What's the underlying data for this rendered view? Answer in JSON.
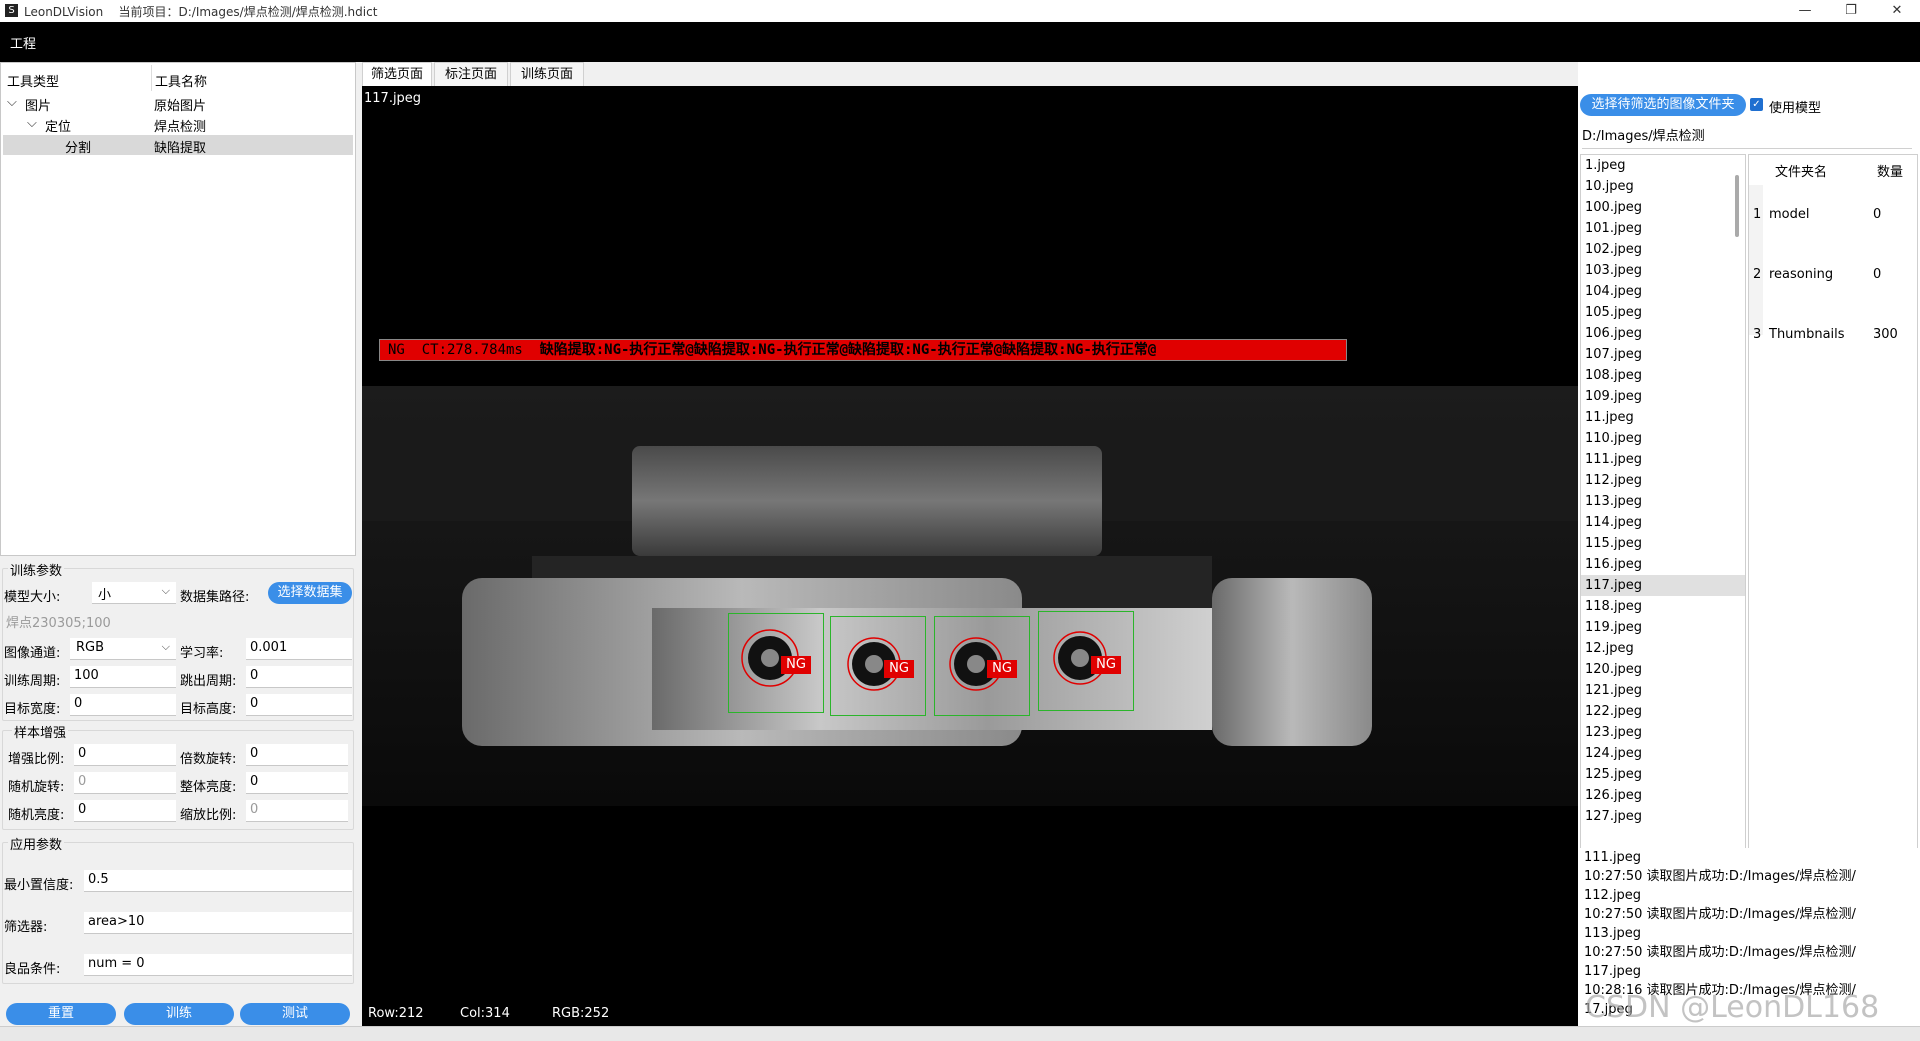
{
  "titlebar": {
    "app_name": "LeonDLVision",
    "project_label": "当前项目：D:/Images/焊点检测/焊点检测.hdict",
    "minimize_glyph": "—",
    "maximize_glyph": "❐",
    "close_glyph": "✕"
  },
  "menu": {
    "project": "工程"
  },
  "tree": {
    "col_type": "工具类型",
    "col_name": "工具名称",
    "rows": [
      {
        "type": "图片",
        "name": "原始图片"
      },
      {
        "type": "定位",
        "name": "焊点检测"
      },
      {
        "type": "分割",
        "name": "缺陷提取"
      }
    ]
  },
  "train": {
    "group_title": "训练参数",
    "model_size_label": "模型大小:",
    "model_size_value": "小",
    "dataset_path_label": "数据集路径:",
    "select_dataset_button": "选择数据集",
    "dataset_value": "焊点230305;100",
    "channel_label": "图像通道:",
    "channel_value": "RGB",
    "lr_label": "学习率:",
    "lr_value": "0.001",
    "epochs_label": "训练周期:",
    "epochs_value": "100",
    "skip_label": "跳出周期:",
    "skip_value": "0",
    "target_width_label": "目标宽度:",
    "target_width_value": "0",
    "target_height_label": "目标高度:",
    "target_height_value": "0"
  },
  "augment": {
    "group_title": "样本增强",
    "ratio_label": "增强比例:",
    "ratio_value": "0",
    "multi_rot_label": "倍数旋转:",
    "multi_rot_value": "0",
    "rand_rot_label": "随机旋转:",
    "rand_rot_value": "0",
    "overall_bright_label": "整体亮度:",
    "overall_bright_value": "0",
    "rand_bright_label": "随机亮度:",
    "rand_bright_value": "0",
    "scale_label": "缩放比例:",
    "scale_value": "0"
  },
  "apply": {
    "group_title": "应用参数",
    "min_conf_label": "最小置信度:",
    "min_conf_value": "0.5",
    "filter_label": "筛选器:",
    "filter_value": "area>10",
    "good_label": "良品条件:",
    "good_value": "num = 0"
  },
  "actions": {
    "reset": "重置",
    "train": "训练",
    "test": "测试"
  },
  "tabs": [
    "筛选页面",
    "标注页面",
    "训练页面"
  ],
  "viewer": {
    "filename": "117.jpeg",
    "banner_prefix": "NG  CT:278.784ms  ",
    "banner_text": "缺陷提取:NG-执行正常@缺陷提取:NG-执行正常@缺陷提取:NG-执行正常@缺陷提取:NG-执行正常@",
    "ng_label": "NG",
    "row": "Row:212",
    "col": "Col:314",
    "rgb": "RGB:252"
  },
  "right": {
    "select_folder_button": "选择待筛选的图像文件夹",
    "use_model_label": "使用模型",
    "folder_path": "D:/Images/焊点检测",
    "files": [
      "1.jpeg",
      "10.jpeg",
      "100.jpeg",
      "101.jpeg",
      "102.jpeg",
      "103.jpeg",
      "104.jpeg",
      "105.jpeg",
      "106.jpeg",
      "107.jpeg",
      "108.jpeg",
      "109.jpeg",
      "11.jpeg",
      "110.jpeg",
      "111.jpeg",
      "112.jpeg",
      "113.jpeg",
      "114.jpeg",
      "115.jpeg",
      "116.jpeg",
      "117.jpeg",
      "118.jpeg",
      "119.jpeg",
      "12.jpeg",
      "120.jpeg",
      "121.jpeg",
      "122.jpeg",
      "123.jpeg",
      "124.jpeg",
      "125.jpeg",
      "126.jpeg",
      "127.jpeg"
    ],
    "folder_table": {
      "col_name": "文件夹名",
      "col_count": "数量",
      "rows": [
        {
          "idx": "1",
          "name": "model",
          "count": "0"
        },
        {
          "idx": "2",
          "name": "reasoning",
          "count": "0"
        },
        {
          "idx": "3",
          "name": "Thumbnails",
          "count": "300"
        }
      ]
    }
  },
  "log": [
    "111.jpeg",
    "10:27:50  读取图片成功:D:/Images/焊点检测/",
    "112.jpeg",
    "10:27:50  读取图片成功:D:/Images/焊点检测/",
    "113.jpeg",
    "10:27:50  读取图片成功:D:/Images/焊点检测/",
    "117.jpeg",
    "10:28:16  读取图片成功:D:/Images/焊点检测/",
    "17.jpeg"
  ],
  "watermark": "CSDN @LeonDL168"
}
